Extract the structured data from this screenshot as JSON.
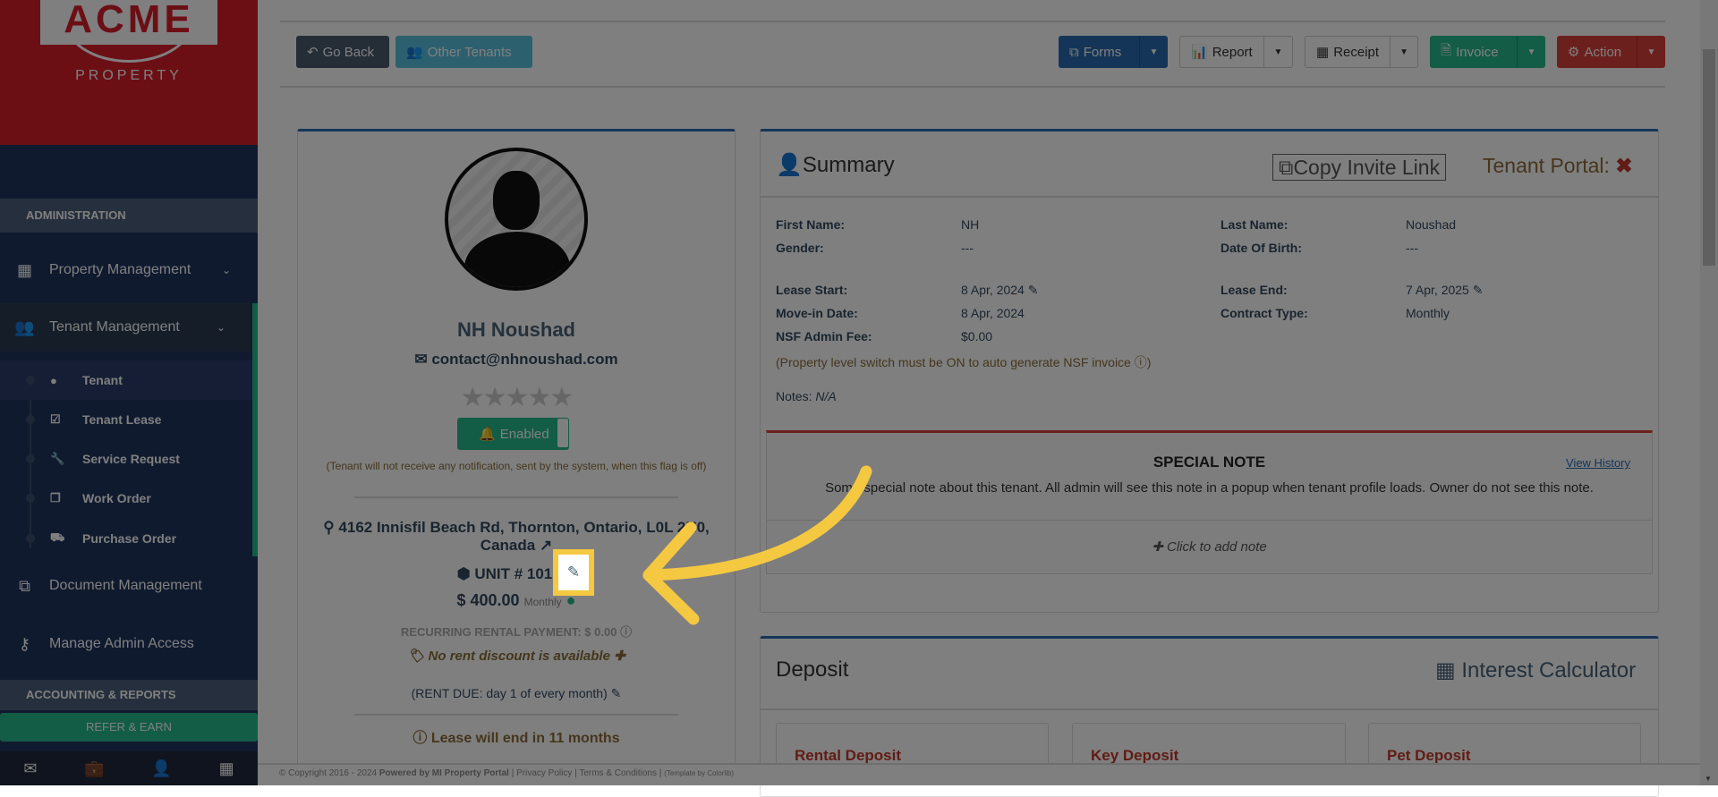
{
  "logo": {
    "text": "ACME",
    "sub": "PROPERTY"
  },
  "sidebar": {
    "section1": "ADMINISTRATION",
    "items": [
      {
        "label": "Property Management"
      },
      {
        "label": "Tenant Management"
      },
      {
        "label": "Document Management"
      },
      {
        "label": "Manage Admin Access"
      }
    ],
    "sub_items": [
      {
        "label": "Tenant"
      },
      {
        "label": "Tenant Lease"
      },
      {
        "label": "Service Request"
      },
      {
        "label": "Work Order"
      },
      {
        "label": "Purchase Order"
      }
    ],
    "section2": "ACCOUNTING & REPORTS",
    "refer": "REFER & EARN"
  },
  "toolbar": {
    "go_back": "Go Back",
    "other_tenants": "Other Tenants",
    "forms": "Forms",
    "report": "Report",
    "receipt": "Receipt",
    "invoice": "Invoice",
    "action": "Action"
  },
  "profile": {
    "name": "NH Noushad",
    "email": "contact@nhnoushad.com",
    "rating": 0,
    "rating_max": 5,
    "notify_label": "Enabled",
    "notify_note": "(Tenant will not receive any notification, sent by the system, when this flag is off)",
    "address": "4162 Innisfil Beach Rd, Thornton, Ontario, L0L 2N0, Canada",
    "unit": "UNIT # 101",
    "rent": "$ 400.00",
    "rent_period": "Monthly",
    "recurring": "RECURRING RENTAL PAYMENT: $ 0.00",
    "discount": "No rent discount is available",
    "rent_due": "(RENT DUE: day 1 of every month)",
    "lease_end_note": "Lease will end in 11 months"
  },
  "summary": {
    "title": "Summary",
    "copy_invite": "Copy Invite Link",
    "portal_label": "Tenant Portal:",
    "first_name_label": "First Name:",
    "first_name": "NH",
    "last_name_label": "Last Name:",
    "last_name": "Noushad",
    "gender_label": "Gender:",
    "gender": "---",
    "dob_label": "Date Of Birth:",
    "dob": "---",
    "lease_start_label": "Lease Start:",
    "lease_start": "8 Apr, 2024",
    "lease_end_label": "Lease End:",
    "lease_end": "7 Apr, 2025",
    "movein_label": "Move-in Date:",
    "movein": "8 Apr, 2024",
    "contract_label": "Contract Type:",
    "contract": "Monthly",
    "nsf_label": "NSF Admin Fee:",
    "nsf": "$0.00",
    "nsf_note": "(Property level switch must be ON to auto generate NSF invoice",
    "notes_label": "Notes:",
    "notes": "N/A"
  },
  "special_note": {
    "title": "SPECIAL NOTE",
    "history": "View History",
    "text": "Some special note about this tenant. All admin will see this note in a popup when tenant profile loads. Owner do not see this note.",
    "add": "Click to add note"
  },
  "deposit": {
    "title": "Deposit",
    "calc": "Interest Calculator",
    "boxes": [
      "Rental Deposit",
      "Key Deposit",
      "Pet Deposit"
    ]
  },
  "footer": {
    "copyright": "© Copyright 2016 - 2024",
    "powered": "Powered by MI Property Portal",
    "privacy": "Privacy Policy",
    "terms": "Terms & Conditions",
    "template": "(Template by Colorlib)"
  },
  "colors": {
    "highlight": "#f5c842",
    "forms": "#2a6bb0",
    "invoice": "#26b98d",
    "action": "#d9403a",
    "sidebar": "#20345f"
  }
}
